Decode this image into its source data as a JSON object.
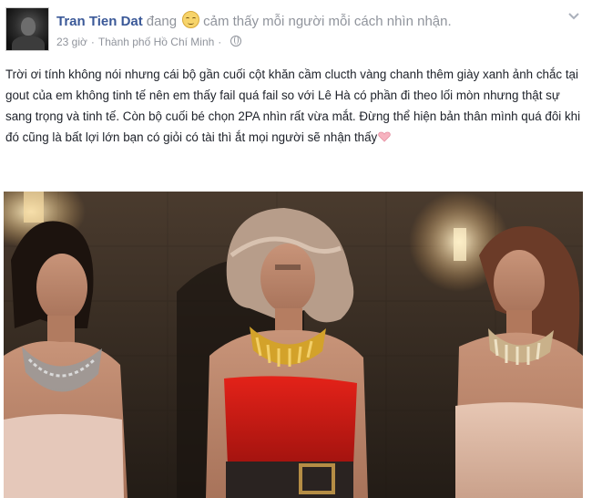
{
  "post": {
    "author": "Tran Tien Dat",
    "verb": "đang",
    "feeling": "cảm thấy mỗi người mỗi cách nhìn nhận.",
    "time": "23 giờ",
    "location": "Thành phố Hồ Chí Minh",
    "body": "Trời ơi tính không nói nhưng cái bộ gần cuối cột khăn cầm clucth vàng chanh thêm giày xanh ảnh chắc tại gout của em không tinh tế nên em thấy fail quá fail so với Lê Hà có phần đi theo lối mòn nhưng thật sự sang trọng và tinh tế. Còn bộ cuối bé chọn 2PA nhìn rất vừa mắt. Đừng thể hiện bản thân mình quá đôi khi đó cũng là bất lợi lớn bạn có giỏi có tài thì ắt mọi người sẽ nhận thấy",
    "icons": {
      "feeling": "relieved-face-icon",
      "privacy": "globe-icon",
      "menu": "chevron-down-icon",
      "heart": "pink-heart-icon"
    },
    "colors": {
      "author": "#3b5998",
      "meta": "#90949c",
      "text": "#1d2129"
    }
  }
}
